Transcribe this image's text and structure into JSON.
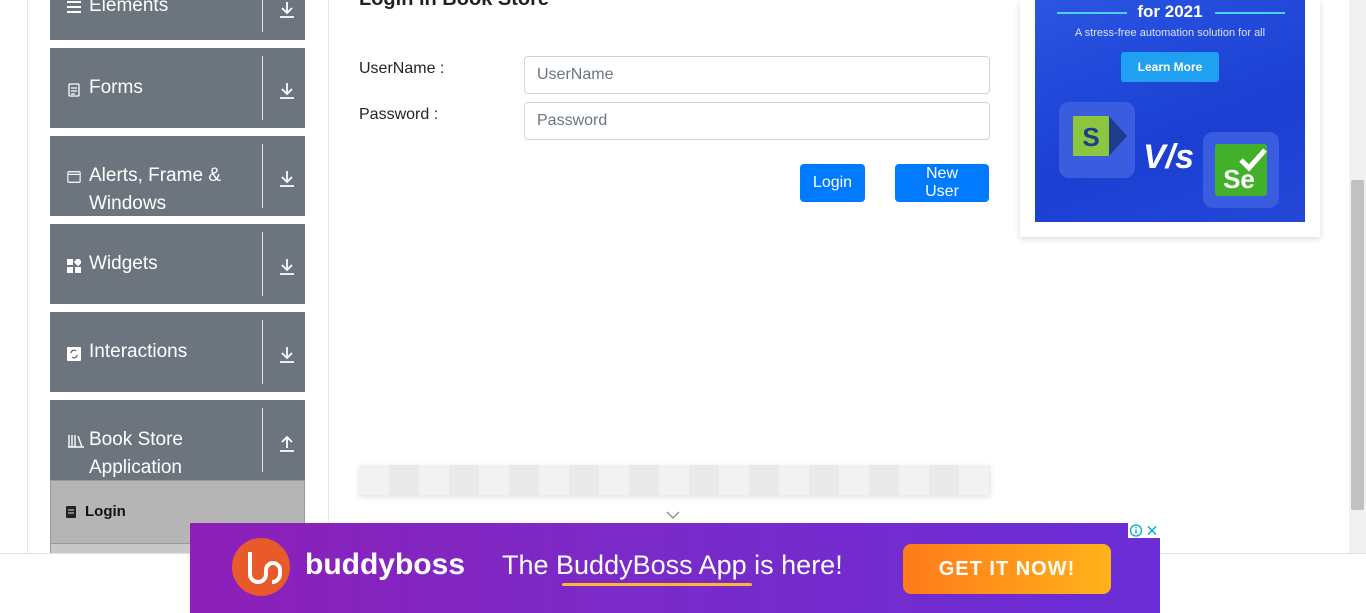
{
  "page": {
    "title": "Login in Book Store"
  },
  "sidebar": {
    "groups": [
      {
        "label": "Elements",
        "icon": "hamburger-icon",
        "expanded": false
      },
      {
        "label": "Forms",
        "icon": "document-icon",
        "expanded": false
      },
      {
        "label": "Alerts, Frame & Windows",
        "icon": "window-icon",
        "expanded": false
      },
      {
        "label": "Widgets",
        "icon": "widgets-grid-icon",
        "expanded": false
      },
      {
        "label": "Interactions",
        "icon": "interaction-icon",
        "expanded": false
      },
      {
        "label": "Book Store Application",
        "icon": "bookshelf-icon",
        "expanded": true
      }
    ],
    "active_item": {
      "label": "Login",
      "icon": "login-doc-icon"
    }
  },
  "form": {
    "username_label": "UserName :",
    "username_placeholder": "UserName",
    "username_value": "",
    "password_label": "Password :",
    "password_placeholder": "Password",
    "password_value": "",
    "login_button": "Login",
    "new_user_button": "New User"
  },
  "right_ad": {
    "headline": "for 2021",
    "subtext": "A stress-free automation solution for all",
    "button": "Learn More",
    "versus": "V/s",
    "left_logo": "S",
    "right_logo": "Se"
  },
  "bottom_ad": {
    "brand": "buddyboss",
    "tagline": "The BuddyBoss App is here!",
    "cta": "GET IT NOW!"
  },
  "colors": {
    "sidebar_bg": "#6c757d",
    "active_item_bg": "#b5b5b5",
    "primary": "#007bff",
    "ad_purple": "#7a2ac8",
    "ad_orange": "#ff9a1a"
  }
}
